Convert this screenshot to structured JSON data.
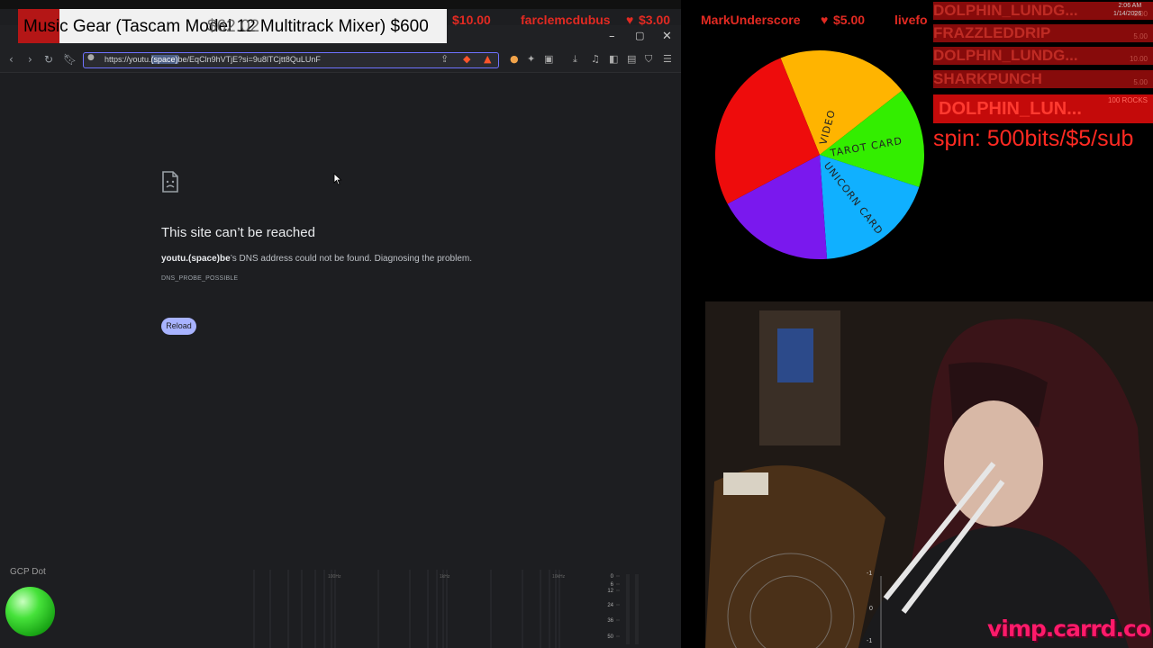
{
  "ticker": {
    "items": [
      {
        "label": "$10.00"
      },
      {
        "label": "farclemcdubus"
      },
      {
        "label": "$3.00"
      },
      {
        "label": "MarkUnderscore"
      },
      {
        "label": "$5.00"
      },
      {
        "label": "livefo"
      }
    ]
  },
  "goal": {
    "text": "Music Gear (Tascam Model 12 Multitrack Mixer) $600",
    "overlay_amount": "$62.02"
  },
  "browser": {
    "url_prefix": "https://youtu.",
    "url_highlight": "(space)",
    "url_suffix": "be/EqCln9hVTjE?si=9u8lTCjtt8QuLUnF",
    "error": {
      "title": "This site can’t be reached",
      "host": "youtu.(space)be",
      "description": "’s DNS address could not be found. Diagnosing the problem.",
      "code": "DNS_PROBE_POSSIBLE",
      "reload_label": "Reload"
    }
  },
  "widgets": {
    "gcp_label": "GCP Dot",
    "gcp_color": "#3fd832",
    "spectrum_labels": [
      "100Hz",
      "1kHz",
      "10kHz"
    ],
    "meter_labels": [
      "0",
      "6",
      "12",
      "24",
      "36",
      "50"
    ]
  },
  "leaderboard": {
    "rows": [
      {
        "name": "DOLPHIN_LUNDG...",
        "sub": "5.00"
      },
      {
        "name": "FRAZZLEDDRIP",
        "sub": "5.00"
      },
      {
        "name": "DOLPHIN_LUNDG...",
        "sub": "10.00"
      },
      {
        "name": "SHARKPUNCH",
        "sub": "5.00"
      },
      {
        "name": "DOLPHIN_LUN...",
        "sub": "100 ROCKS"
      }
    ],
    "spin_text": "spin: 500bits/$5/sub"
  },
  "clock": {
    "time": "2:06 AM",
    "date": "1/14/2026"
  },
  "wheel": {
    "segments": [
      {
        "label": "VIDEO",
        "color": "#ffb400"
      },
      {
        "label": "TAROT CARD",
        "color": "#33ee00"
      },
      {
        "label": "UNICORN CARD",
        "color": "#10b0ff"
      },
      {
        "label": "",
        "color": "#7a18ee"
      },
      {
        "label": "",
        "color": "#ee0c0c"
      }
    ]
  },
  "cam": {
    "watermark": "vimp.carrd.co",
    "meter_labels": [
      "-1",
      "0",
      "-1"
    ]
  }
}
